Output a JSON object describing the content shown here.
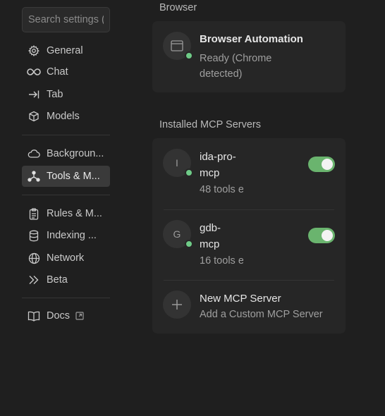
{
  "sidebar": {
    "search_placeholder": "Search settings (",
    "items": [
      {
        "label": "General",
        "icon": "gear-icon"
      },
      {
        "label": "Chat",
        "icon": "infinity-icon"
      },
      {
        "label": "Tab",
        "icon": "tab-arrow-icon"
      },
      {
        "label": "Models",
        "icon": "cube-icon"
      },
      {
        "label": "Backgroun...",
        "icon": "cloud-icon"
      },
      {
        "label": "Tools & M...",
        "icon": "nodes-icon",
        "active": true
      },
      {
        "label": "Rules & M...",
        "icon": "clipboard-icon"
      },
      {
        "label": "Indexing ...",
        "icon": "database-icon"
      },
      {
        "label": "Network",
        "icon": "globe-icon"
      },
      {
        "label": "Beta",
        "icon": "double-chevron-icon"
      },
      {
        "label": "Docs",
        "icon": "book-icon",
        "external_icon": "external-link-icon"
      }
    ]
  },
  "browser": {
    "section_title": "Browser",
    "title": "Browser Automation",
    "status_line1": "Ready (Chrome",
    "status_line2": "detected)"
  },
  "mcp": {
    "section_title": "Installed MCP Servers",
    "servers": [
      {
        "initial": "I",
        "name_line1": "ida-pro-",
        "name_line2": "mcp",
        "tools": "48 tools e",
        "enabled": true
      },
      {
        "initial": "G",
        "name_line1": "gdb-",
        "name_line2": "mcp",
        "tools": "16 tools e",
        "enabled": true
      }
    ],
    "new_server": {
      "title": "New MCP Server",
      "subtitle": "Add a Custom MCP Server",
      "icon": "plus-icon"
    }
  },
  "colors": {
    "accent_green": "#6ab46e",
    "status_dot": "#6fcb87",
    "background": "#1f1f1f",
    "card": "#262626"
  }
}
